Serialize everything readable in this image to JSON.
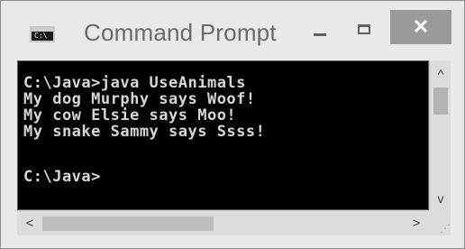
{
  "window": {
    "title": "Command Prompt",
    "icon": "console-icon",
    "icon_glyph": "C:\\",
    "controls": {
      "minimize_icon": "minimize-icon",
      "maximize_icon": "maximize-icon",
      "close_label": "✕"
    }
  },
  "console": {
    "lines": [
      "C:\\Java>java UseAnimals",
      "My dog Murphy says Woof!",
      "My cow Elsie says Moo!",
      "My snake Sammy says Ssss!",
      "",
      "C:\\Java>"
    ]
  },
  "scrollbars": {
    "up_arrow": "^",
    "down_arrow": "v",
    "left_arrow": "<",
    "right_arrow": ">"
  },
  "colors": {
    "console_background": "#000000",
    "console_text": "#d6d6d6",
    "close_button": "#9a9a9a"
  }
}
